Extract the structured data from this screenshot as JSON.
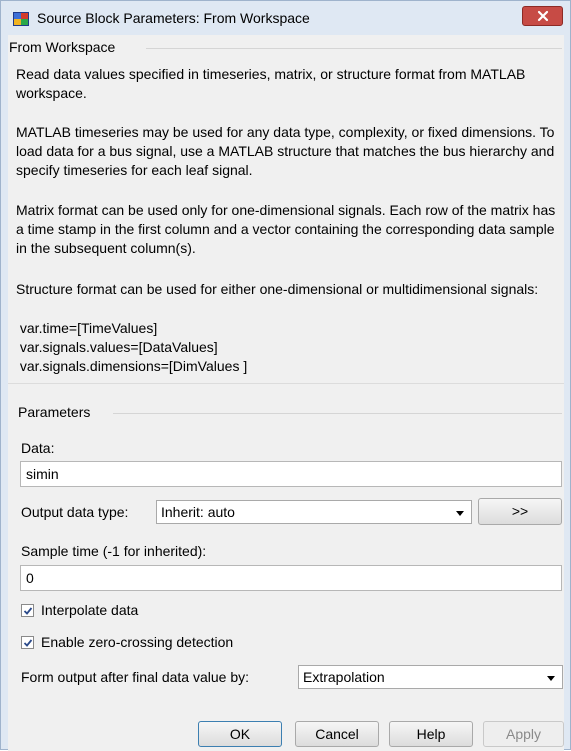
{
  "window": {
    "title": "Source Block Parameters: From Workspace",
    "app_icon": "simulink-icon",
    "close_icon": "close-icon"
  },
  "block": {
    "heading": "From Workspace",
    "desc1": "Read data values specified in timeseries, matrix, or structure format from MATLAB workspace.",
    "desc2": "MATLAB timeseries may be used for any data type, complexity, or fixed dimensions.  To load data for a bus signal, use a MATLAB structure that matches the bus hierarchy and specify timeseries for each leaf signal.",
    "desc3": "Matrix format can be used only for one-dimensional signals. Each row of the matrix has a time stamp in the first column and a vector containing the corresponding data sample in the subsequent column(s).",
    "desc4": "Structure format can be used for either one-dimensional or multidimensional signals:",
    "code1": " var.time=[TimeValues]",
    "code2": " var.signals.values=[DataValues]",
    "code3": " var.signals.dimensions=[DimValues ]"
  },
  "parameters": {
    "heading": "Parameters",
    "data_label": "Data:",
    "data_value": "simin",
    "output_type_label": "Output data type:",
    "output_type_value": "Inherit: auto",
    "expand_button": ">>",
    "sample_time_label": "Sample time (-1 for inherited):",
    "sample_time_value": "0",
    "interpolate_label": "Interpolate data",
    "interpolate_checked": true,
    "zero_crossing_label": "Enable zero-crossing detection",
    "zero_crossing_checked": true,
    "form_output_label": "Form output after final data value by:",
    "form_output_value": "Extrapolation"
  },
  "buttons": {
    "ok": "OK",
    "cancel": "Cancel",
    "help": "Help",
    "apply": "Apply"
  },
  "colors": {
    "close_button": "#c74b45",
    "window_frame": "#dfe8f3",
    "panel_bg": "#f0f0f0"
  }
}
